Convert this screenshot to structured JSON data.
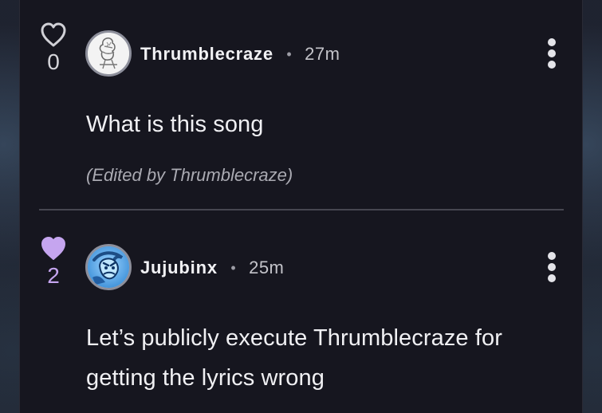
{
  "comments": [
    {
      "likes": "0",
      "liked": false,
      "username": "Thrumblecraze",
      "separator": "•",
      "time": "27m",
      "body": "What is this song",
      "edited": "(Edited by Thrumblecraze)",
      "icons": {
        "heart": "heart-outline-icon",
        "more": "more-vertical-icon"
      },
      "avatar": "thrumblecraze-avatar"
    },
    {
      "likes": "2",
      "liked": true,
      "username": "Jujubinx",
      "separator": "•",
      "time": "25m",
      "body": "Let’s publicly execute Thrumblecraze for getting the lyrics wrong",
      "icons": {
        "heart": "heart-filled-icon",
        "more": "more-vertical-icon"
      },
      "avatar": "jujubinx-avatar"
    }
  ],
  "colors": {
    "background": "#15151d",
    "panel": "#16161f",
    "text": "#f0f0f3",
    "muted": "#aaaab2",
    "like_active": "#c5a5ef",
    "divider": "#464650"
  }
}
